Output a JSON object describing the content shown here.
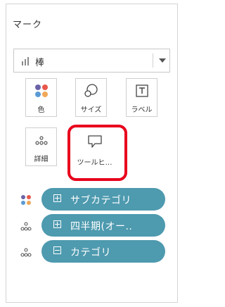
{
  "marks_panel": {
    "title": "マーク",
    "mark_type": {
      "value": "棒"
    },
    "cards": [
      {
        "key": "color",
        "label": "色"
      },
      {
        "key": "size",
        "label": "サイズ"
      },
      {
        "key": "label",
        "label": "ラベル"
      },
      {
        "key": "detail",
        "label": "詳細"
      },
      {
        "key": "tooltip",
        "label": "ツールヒ…"
      }
    ],
    "fields": [
      {
        "label": "サブカテゴリ",
        "mark": "color",
        "state": "expand"
      },
      {
        "label": "四半期(オー..",
        "mark": "detail",
        "state": "expand"
      },
      {
        "label": "カテゴリ",
        "mark": "detail",
        "state": "collapse"
      }
    ]
  },
  "colors": {
    "pill": "#4e9aaf",
    "highlight": "#e8001c",
    "palette": [
      "#6b63a8",
      "#e8584a",
      "#5b9bd5",
      "#f0a85a"
    ]
  }
}
